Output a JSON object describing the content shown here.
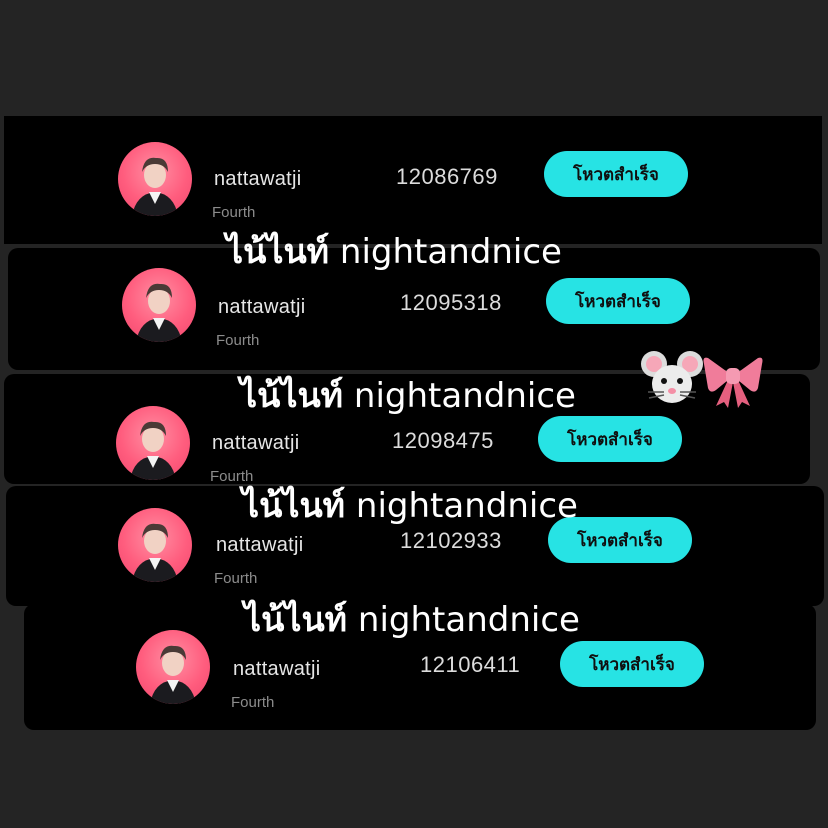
{
  "rows": [
    {
      "username": "nattawatji",
      "subtitle": "Fourth",
      "votes": "12086769",
      "button": "โหวตสำเร็จ"
    },
    {
      "username": "nattawatji",
      "subtitle": "Fourth",
      "votes": "12095318",
      "button": "โหวตสำเร็จ"
    },
    {
      "username": "nattawatji",
      "subtitle": "Fourth",
      "votes": "12098475",
      "button": "โหวตสำเร็จ"
    },
    {
      "username": "nattawatji",
      "subtitle": "Fourth",
      "votes": "12102933",
      "button": "โหวตสำเร็จ"
    },
    {
      "username": "nattawatji",
      "subtitle": "Fourth",
      "votes": "12106411",
      "button": "โหวตสำเร็จ"
    }
  ],
  "captions": [
    {
      "thai": "ไน้ไนท์",
      "latin": "nightandnice"
    },
    {
      "thai": "ไน้ไนท์",
      "latin": "nightandnice"
    },
    {
      "thai": "ไน้ไนท์",
      "latin": "nightandnice"
    },
    {
      "thai": "ไน้ไนท์",
      "latin": "nightandnice"
    }
  ],
  "decorations": {
    "emoji_icons": [
      "mouse-face-icon",
      "ribbon-icon"
    ]
  },
  "colors": {
    "background": "#242424",
    "strip": "#000000",
    "button": "#27e3e4",
    "avatar": "#ff5d7e"
  }
}
